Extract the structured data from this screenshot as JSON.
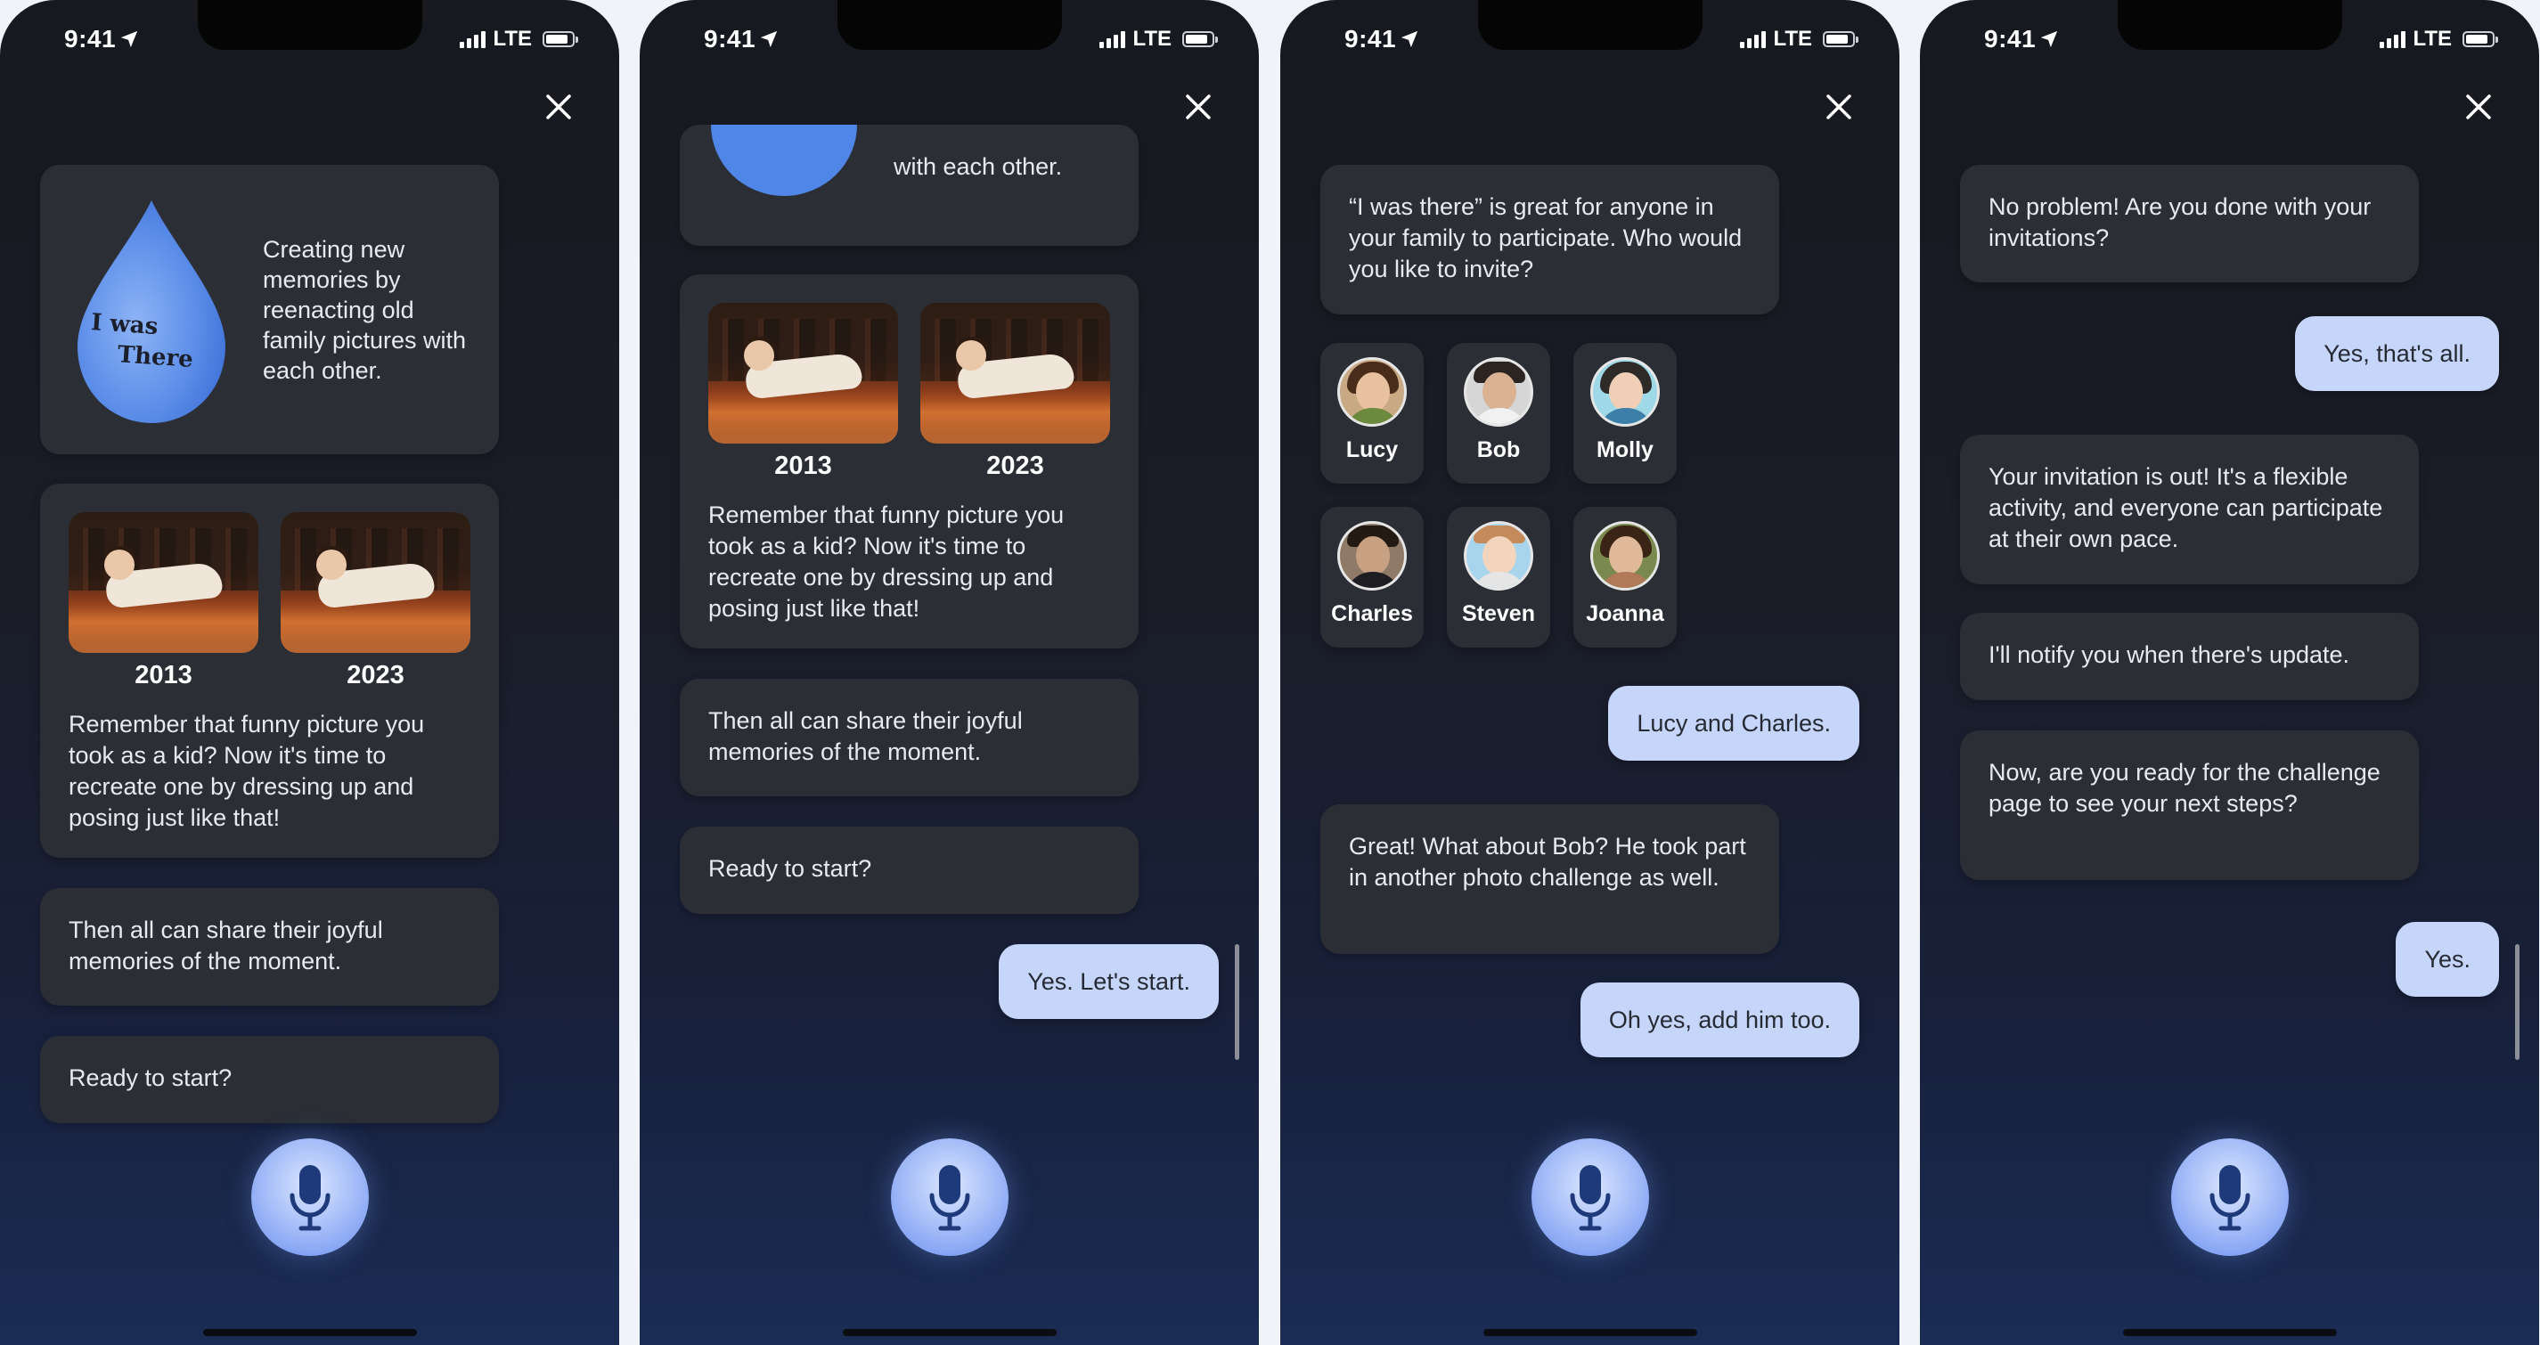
{
  "status": {
    "time": "9:41",
    "network": "LTE"
  },
  "colors": {
    "accent": "#c6d6fb",
    "bot_bubble": "#2b2e35",
    "mic": "#a9c0f8"
  },
  "screens": [
    {
      "intro_text": "Creating new memories by reenacting old family pictures with each other.",
      "logo_text_1": "I was",
      "logo_text_2": "There",
      "photo_year_1": "2013",
      "photo_year_2": "2023",
      "photo_text": "Remember that funny picture you took as a kid? Now it's time to recreate one by dressing up and posing just like that!",
      "msg_share": "Then all can share their joyful memories of the moment.",
      "msg_ready": "Ready to start?"
    },
    {
      "intro_partial": "with each other.",
      "photo_year_1": "2013",
      "photo_year_2": "2023",
      "photo_text": "Remember that funny picture you took as a kid? Now it's time to recreate one by dressing up and posing just like that!",
      "msg_share": "Then all can share their joyful memories of the moment.",
      "msg_ready": "Ready to start?",
      "user_reply": "Yes. Let's start."
    },
    {
      "msg_invite": "“I was there” is great for anyone in your family to participate. Who would you like to invite?",
      "contacts": [
        "Lucy",
        "Bob",
        "Molly",
        "Charles",
        "Steven",
        "Joanna"
      ],
      "user_reply_1": "Lucy and Charles.",
      "msg_bob": "Great! What about Bob? He took part in another photo challenge as well.",
      "user_reply_2": "Oh yes, add him too."
    },
    {
      "msg_done": "No problem! Are you done with your invitations?",
      "user_reply_1": "Yes, that's all.",
      "msg_out": "Your invitation is out! It's a flexible activity, and everyone can participate at their own pace.",
      "msg_notify": "I'll notify you when there's update.",
      "msg_next": "Now, are you ready for the challenge page to see your next steps?",
      "user_reply_2": "Yes."
    }
  ]
}
